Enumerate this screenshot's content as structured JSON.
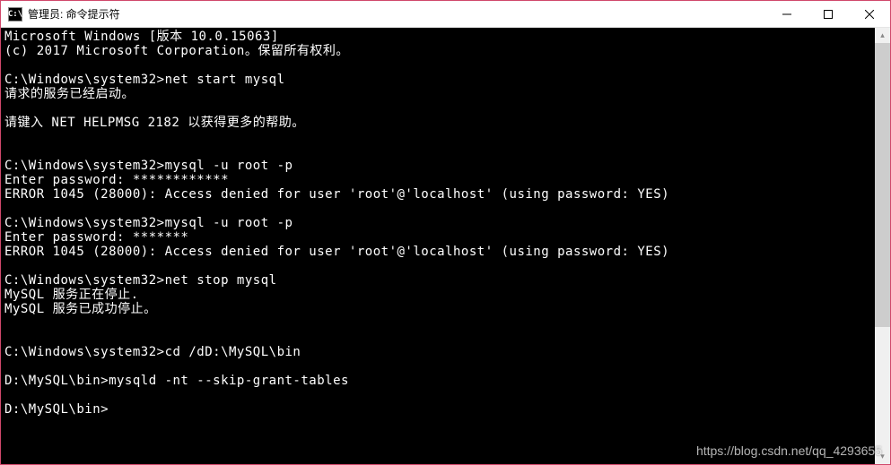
{
  "window": {
    "icon_text": "C:\\",
    "title": "管理员: 命令提示符"
  },
  "terminal": {
    "lines": [
      "Microsoft Windows [版本 10.0.15063]",
      "(c) 2017 Microsoft Corporation。保留所有权利。",
      "",
      "C:\\Windows\\system32>net start mysql",
      "请求的服务已经启动。",
      "",
      "请键入 NET HELPMSG 2182 以获得更多的帮助。",
      "",
      "",
      "C:\\Windows\\system32>mysql -u root -p",
      "Enter password: ************",
      "ERROR 1045 (28000): Access denied for user 'root'@'localhost' (using password: YES)",
      "",
      "C:\\Windows\\system32>mysql -u root -p",
      "Enter password: *******",
      "ERROR 1045 (28000): Access denied for user 'root'@'localhost' (using password: YES)",
      "",
      "C:\\Windows\\system32>net stop mysql",
      "MySQL 服务正在停止.",
      "MySQL 服务已成功停止。",
      "",
      "",
      "C:\\Windows\\system32>cd /dD:\\MySQL\\bin",
      "",
      "D:\\MySQL\\bin>mysqld -nt --skip-grant-tables",
      "",
      "D:\\MySQL\\bin>"
    ]
  },
  "watermark": {
    "text": "https://blog.csdn.net/qq_4293655"
  }
}
